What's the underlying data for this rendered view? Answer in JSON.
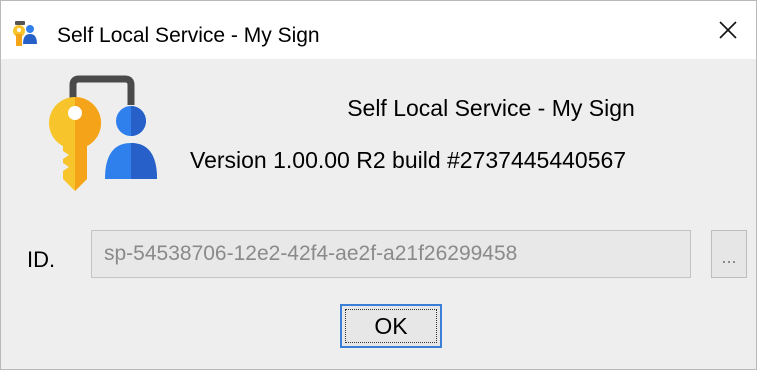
{
  "window": {
    "title": "Self Local Service - My Sign"
  },
  "title_bar": {
    "close_glyph": "✕"
  },
  "about": {
    "app_name": "Self Local Service - My Sign",
    "version": "Version 1.00.00 R2 build #2737445440567"
  },
  "id_row": {
    "label": "ID.",
    "value": "sp-54538706-12e2-42f4-ae2f-a21f26299458",
    "browse_label": "..."
  },
  "actions": {
    "ok_label": "OK"
  },
  "icons": {
    "title_icon": "key-user-icon",
    "logo": "key-user-logo",
    "close": "close-icon"
  },
  "colors": {
    "key_yellow": "#f7c52b",
    "key_orange": "#f5a318",
    "user_blue": "#2f80ed",
    "user_blue_dark": "#2660c8",
    "focus_border": "#3b7fd6",
    "dialog_bg": "#eeeeee"
  }
}
